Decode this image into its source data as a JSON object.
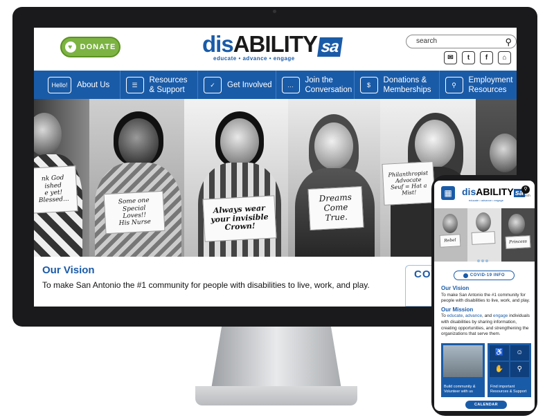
{
  "brand": {
    "prefix": "dis",
    "main": "ABILITY",
    "suffix": "sa",
    "tagline": "educate • advance • engage",
    "colors": {
      "primary": "#1a5ba8",
      "accent": "#7cb342"
    }
  },
  "header": {
    "donate_label": "DONATE",
    "search_placeholder": "search",
    "social_icons": [
      "email-icon",
      "twitter-icon",
      "facebook-icon",
      "home-icon"
    ]
  },
  "nav": {
    "hello_badge": "Hello!",
    "items": [
      {
        "label": "About Us",
        "icon": "hello-bubble-icon"
      },
      {
        "label": "Resources & Support",
        "icon": "document-icon"
      },
      {
        "label": "Get Involved",
        "icon": "clipboard-icon"
      },
      {
        "label": "Join the Conversation",
        "icon": "chat-icon"
      },
      {
        "label": "Donations & Memberships",
        "icon": "donation-hand-icon"
      },
      {
        "label": "Employment Resources",
        "icon": "job-search-icon"
      }
    ]
  },
  "hero": {
    "signs": [
      "nk God\nished\ne yet!\nBlessed...",
      "Some one\nSpecial\nLoves!!\nHis Nurse",
      "Always wear\nyour invisible\nCrown!",
      "Dreams\nCome\nTrue.",
      "Philanthropist\nAdvocate\nSeuf = Hat a Mist!"
    ]
  },
  "vision": {
    "title": "Our Vision",
    "text": "To make San Antonio the #1 community for people with disabilities to live, work, and play.",
    "covid_label": "COVI"
  },
  "mobile": {
    "search_label": "search",
    "hero_signs": [
      "Rebel",
      "",
      "Princess"
    ],
    "covid_button": "COVID-19 INFO",
    "vision_title": "Our Vision",
    "vision_text": "To make San Antonio the #1 community for people with disabilities to live, work, and play.",
    "mission_title": "Our Mission",
    "mission_to": "To ",
    "mission_educate": "educate",
    "mission_sep1": ", ",
    "mission_advance": "advance",
    "mission_and": ", and ",
    "mission_engage": "engage",
    "mission_rest": " individuals with disabilities by sharing information, creating opportunities, and strengthening the organizations that serve them.",
    "cards": [
      {
        "caption": "Build community & Volunteer with us"
      },
      {
        "caption": "Find important Resources & Support"
      }
    ],
    "calendar_label": "CALENDAR"
  }
}
